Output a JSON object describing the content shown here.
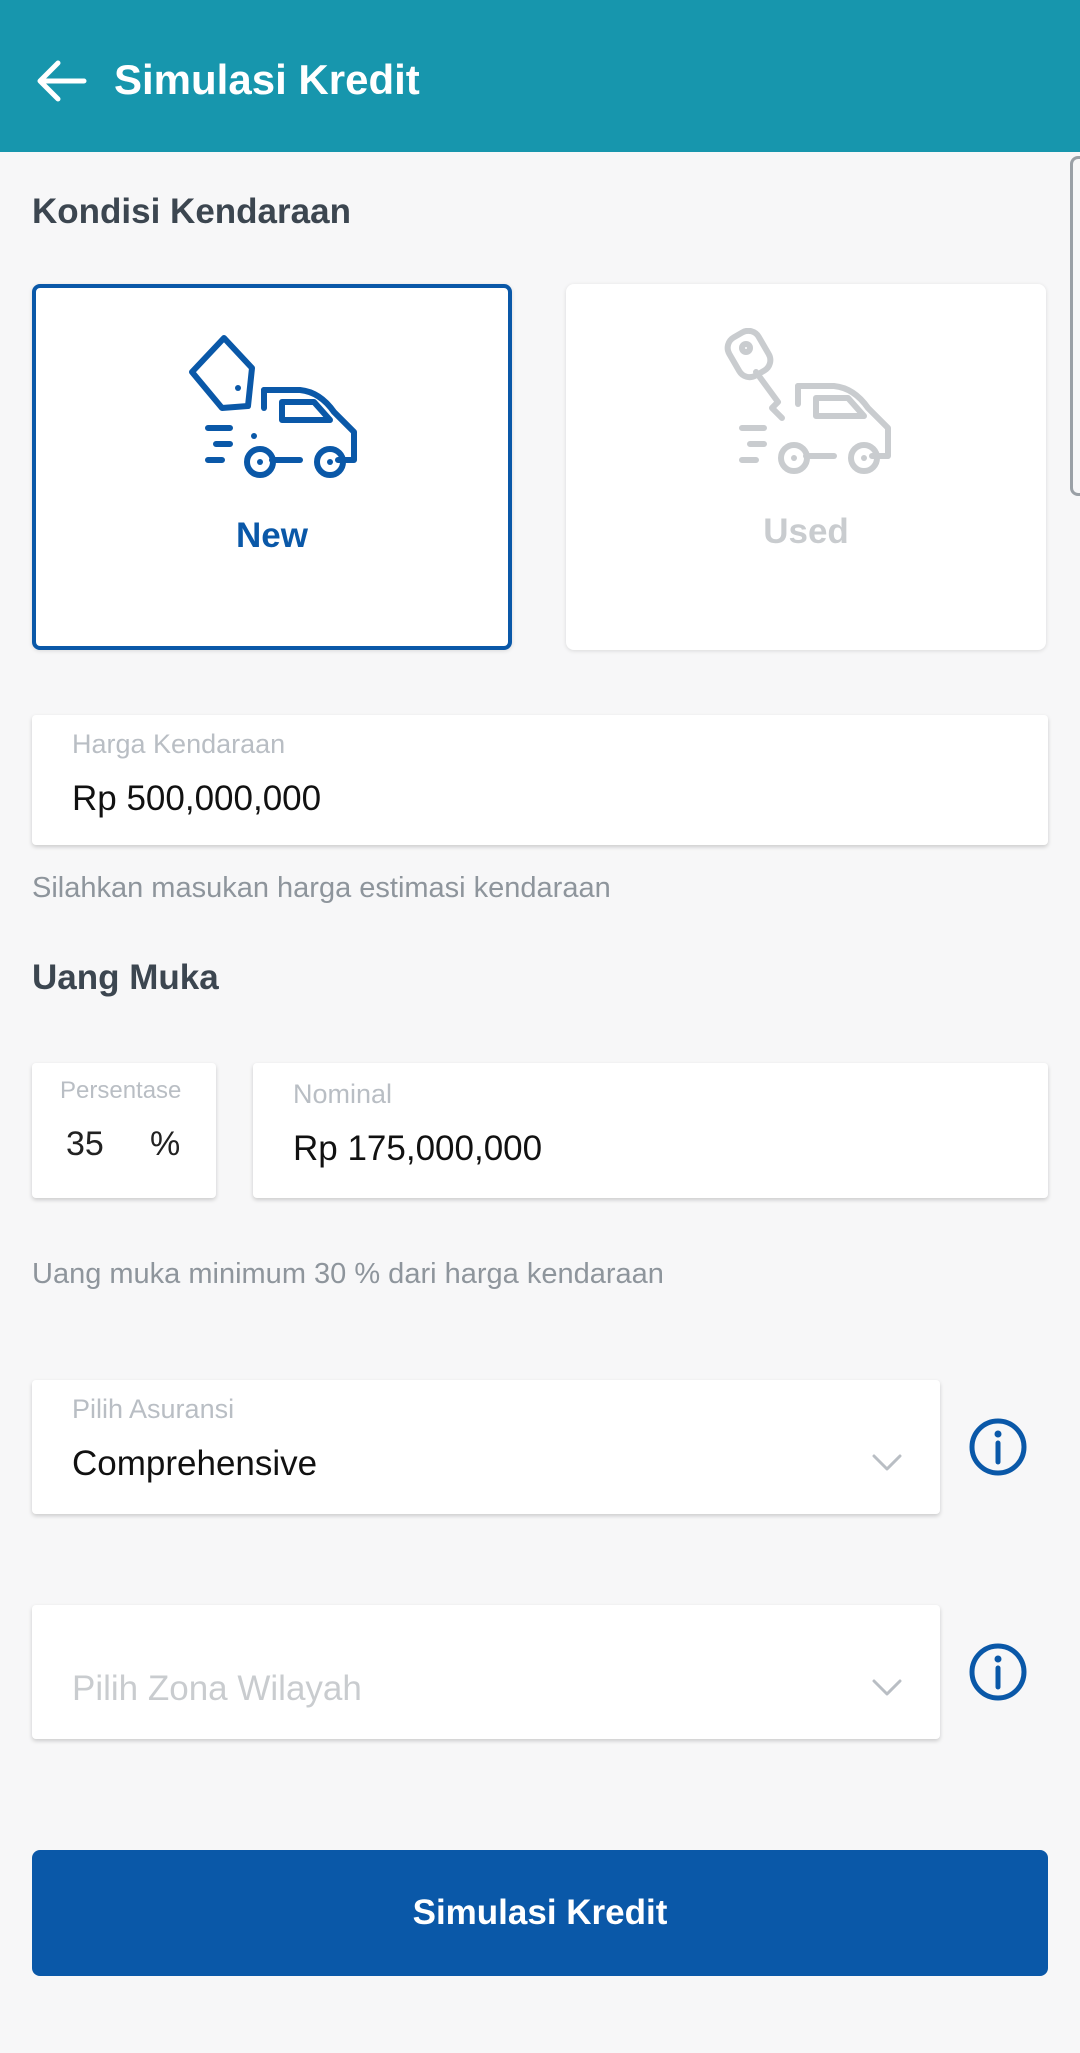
{
  "appbar": {
    "title": "Simulasi Kredit",
    "icon": "arrow-left-icon",
    "color": "#1796ad"
  },
  "kondisi": {
    "title": "Kondisi Kendaraan",
    "options": [
      {
        "label": "New",
        "icon": "new-car-tag-icon",
        "selected": true,
        "color": "#0a58a8"
      },
      {
        "label": "Used",
        "icon": "used-car-key-icon",
        "selected": false,
        "color": "#c9cccf"
      }
    ]
  },
  "harga": {
    "label": "Harga Kendaraan",
    "value": "Rp 500,000,000",
    "helper": "Silahkan masukan harga estimasi kendaraan"
  },
  "uang_muka": {
    "title": "Uang Muka",
    "persentase_label": "Persentase",
    "persentase_value": "35",
    "persentase_unit": "%",
    "nominal_label": "Nominal",
    "nominal_value": "Rp 175,000,000",
    "helper": "Uang muka minimum 30 % dari harga kendaraan"
  },
  "asuransi": {
    "label": "Pilih Asuransi",
    "value": "Comprehensive",
    "icon": "info-icon"
  },
  "zona": {
    "placeholder": "Pilih Zona Wilayah",
    "icon": "info-icon"
  },
  "submit": {
    "label": "Simulasi Kredit",
    "color": "#0a58a8"
  }
}
